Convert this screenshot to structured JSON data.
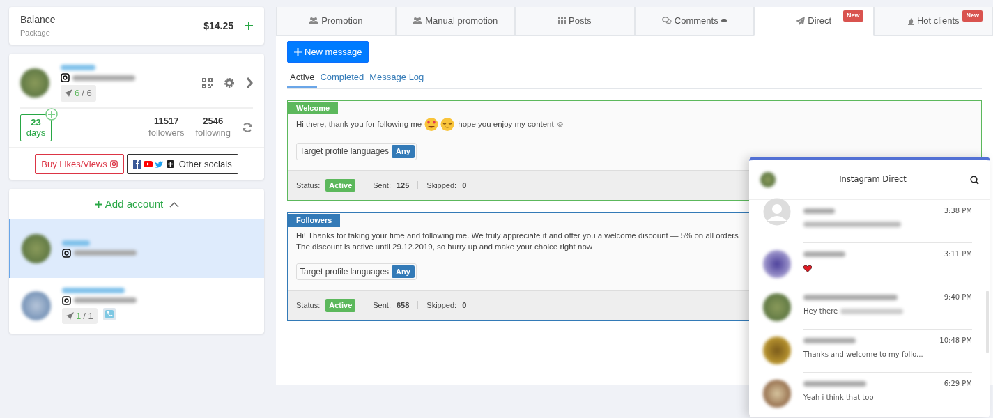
{
  "balance": {
    "label": "Balance",
    "sublabel": "Package",
    "amount": "$14.25"
  },
  "account_card": {
    "rockets_done": "6",
    "rockets_total": "/ 6",
    "days": "23",
    "days_label": "days",
    "followers": "11517",
    "followers_label": "followers",
    "following": "2546",
    "following_label": "following",
    "buy_button": "Buy Likes/Views",
    "other_button": "Other socials"
  },
  "accounts": {
    "add_label": "Add account",
    "expanded": true,
    "items": [
      {
        "selected": true,
        "phone": false
      },
      {
        "selected": false,
        "rockets_done": "1",
        "rockets_total": "/ 1",
        "phone": true
      }
    ]
  },
  "tabs": [
    {
      "label": "Promotion",
      "selected": false
    },
    {
      "label": "Manual promotion",
      "selected": false
    },
    {
      "label": "Posts",
      "selected": false
    },
    {
      "label": "Comments",
      "selected": false
    },
    {
      "label": "Direct",
      "selected": true,
      "badge": "New"
    },
    {
      "label": "Hot clients",
      "selected": false,
      "badge": "New"
    }
  ],
  "new_message_button": "New message",
  "subtabs": [
    {
      "label": "Active",
      "selected": true
    },
    {
      "label": "Completed",
      "selected": false
    },
    {
      "label": "Message Log",
      "selected": false
    }
  ],
  "messages": [
    {
      "title": "Welcome",
      "color": "#5cb85c",
      "lines": [
        "Hi there, thank you for following me"
      ],
      "emoji_after_first": true,
      "tail": "hope you enjoy my content ☺",
      "languages_label": "Target profile languages",
      "languages": "Any",
      "status_label": "Status:",
      "status": "Active",
      "sent_label": "Sent:",
      "sent": "125",
      "skipped_label": "Skipped:",
      "skipped": "0"
    },
    {
      "title": "Followers",
      "color": "#337ab7",
      "lines": [
        "Hi! Thanks for taking your time and following me. We truly appreciate it and offer you a welcome discount — 5% on all orders",
        "The discount is active until 29.12.2019, so hurry up and make your choice right now"
      ],
      "emoji_after_first": false,
      "languages_label": "Target profile languages",
      "languages": "Any",
      "status_label": "Status:",
      "status": "Active",
      "sent_label": "Sent:",
      "sent": "658",
      "skipped_label": "Skipped:",
      "skipped": "0"
    }
  ],
  "direct_panel": {
    "title": "Instagram Direct",
    "conversations": [
      {
        "time": "3:38 PM",
        "kind": "blurred"
      },
      {
        "time": "3:11 PM",
        "kind": "heart"
      },
      {
        "time": "9:40 PM",
        "kind": "partial",
        "preview": "Hey there"
      },
      {
        "time": "10:48 PM",
        "kind": "text",
        "preview": "Thanks and welcome to my follo..."
      },
      {
        "time": "6:29 PM",
        "kind": "text",
        "preview": "Yeah i think that too"
      }
    ]
  }
}
